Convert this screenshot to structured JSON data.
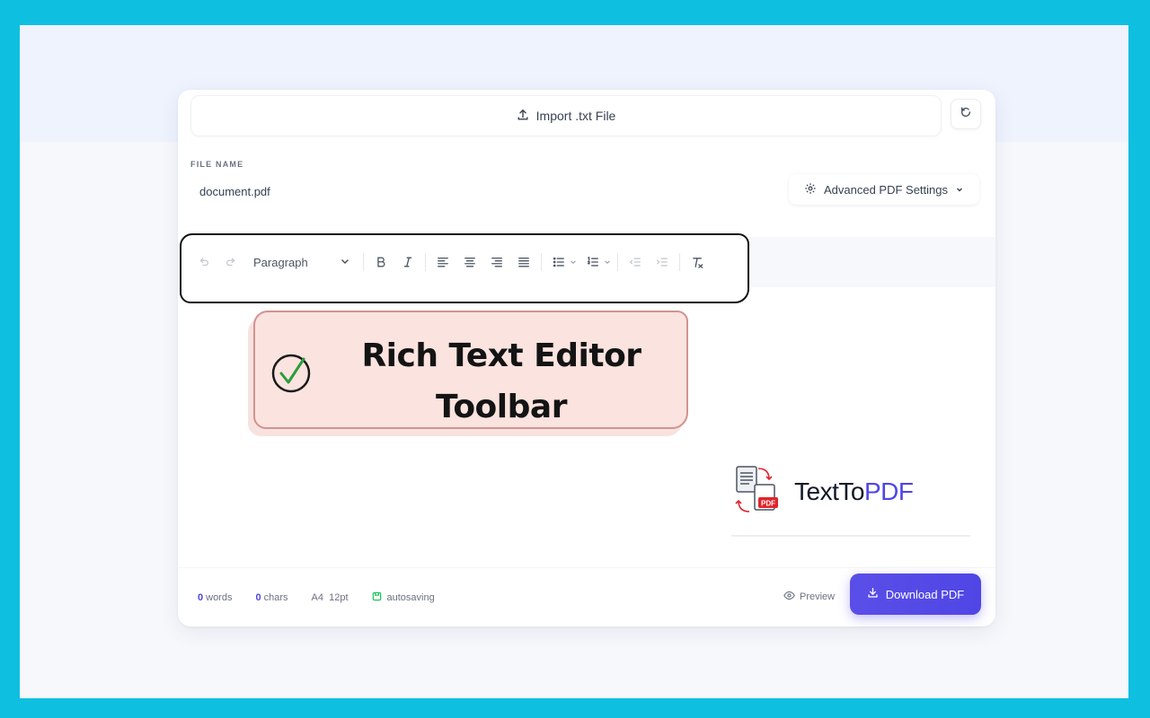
{
  "import": {
    "label": "Import .txt File"
  },
  "file": {
    "label": "FILE NAME",
    "value": "document.pdf",
    "placeholder": "document.pdf"
  },
  "advanced": {
    "label": "Advanced PDF Settings"
  },
  "toolbar": {
    "paragraph_label": "Paragraph"
  },
  "callout": {
    "line1": "Rich Text Editor",
    "line2": "Toolbar"
  },
  "brand": {
    "name_part1": "TextTo",
    "name_part2": "PDF",
    "badge": "PDF"
  },
  "footer": {
    "words_count": "0",
    "words_label": "words",
    "chars_count": "0",
    "chars_label": "chars",
    "page_size": "A4",
    "font_size": "12pt",
    "autosave": "autosaving",
    "preview_label": "Preview",
    "download_label": "Download PDF"
  },
  "colors": {
    "accent": "#4f46e5",
    "frame": "#0fbfe0",
    "callout_bg": "#fbe3df",
    "callout_border": "#d2938f"
  }
}
